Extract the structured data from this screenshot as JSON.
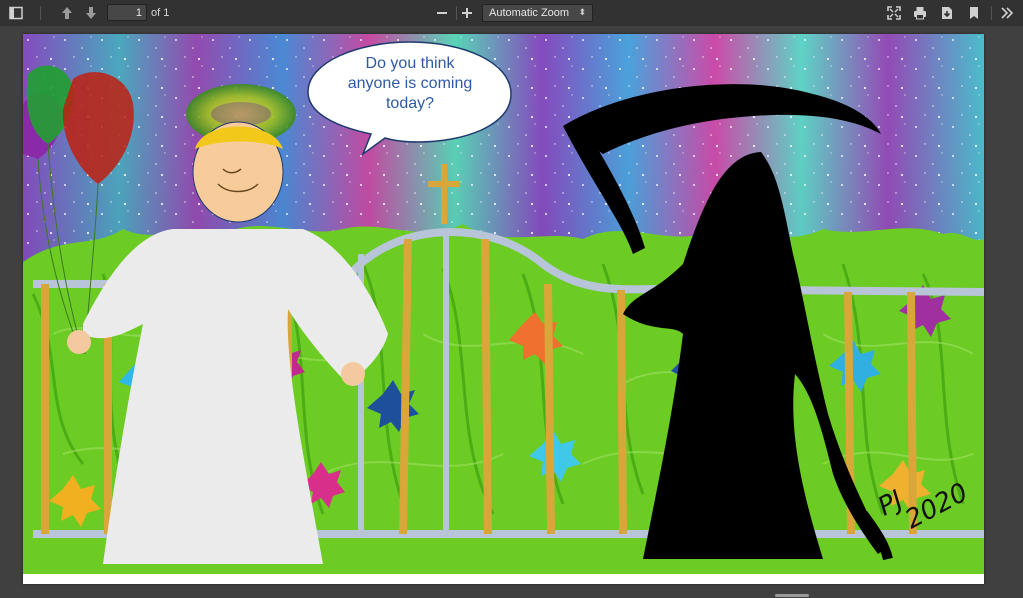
{
  "toolbar": {
    "page_number": "1",
    "page_count": "of 1",
    "zoom_value": "Automatic Zoom"
  },
  "document": {
    "speech_bubble": {
      "line1": "Do you think",
      "line2": "anyone is coming",
      "line3": "today?"
    },
    "signature_line1": "PJ",
    "signature_line2": "2020"
  },
  "icons": {
    "sidebar": "sidebar-toggle-icon",
    "prev": "arrow-up-icon",
    "next": "arrow-down-icon",
    "zoom_out": "minus-icon",
    "zoom_in": "plus-icon",
    "presentation": "presentation-icon",
    "print": "print-icon",
    "download": "download-icon",
    "bookmark": "bookmark-icon",
    "tools": "double-chevron-icon"
  },
  "colors": {
    "toolbar_bg": "#323232",
    "viewer_bg": "#404040",
    "grass": "#6ccc24",
    "gold_bars": "#d9a63a",
    "gate_silver": "#b8c4d8",
    "speech_text": "#2e5aa3"
  }
}
